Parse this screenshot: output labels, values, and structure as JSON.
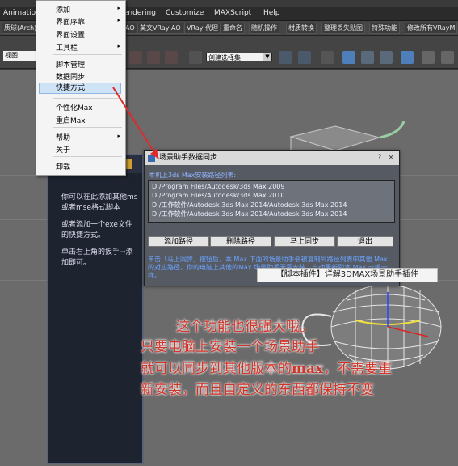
{
  "menubar": {
    "items": [
      "Animatio",
      "Rendering",
      "Customize",
      "MAXScript",
      "Help"
    ]
  },
  "plugin_toolbar": {
    "items": [
      "质球(Arch)",
      "AO",
      "英文VRay AO",
      "VRay 代理",
      "重命名",
      "随机操作",
      "材质转换",
      "整理丢失贴图",
      "特殊功能",
      "修改所有VRayM"
    ]
  },
  "icon_toolbar": {
    "view_dropdown": "视图",
    "selection_set": "创建选择集"
  },
  "dropdown_menu": {
    "items": [
      {
        "label": "添加",
        "submenu": true
      },
      {
        "label": "界面序靠",
        "submenu": true
      },
      {
        "label": "界面设置",
        "submenu": false
      },
      {
        "label": "工具栏",
        "submenu": true
      },
      {
        "label": "脚本管理",
        "submenu": false
      },
      {
        "label": "数据同步",
        "submenu": false
      },
      {
        "label": "快捷方式",
        "submenu": false
      },
      {
        "label": "个性化Max",
        "submenu": false
      },
      {
        "label": "重启Max",
        "submenu": false
      },
      {
        "label": "帮助",
        "submenu": true
      },
      {
        "label": "关于",
        "submenu": false
      },
      {
        "label": "卸载",
        "submenu": false
      }
    ],
    "submenu_arrow": "▸"
  },
  "help_panel": {
    "para1": "你可以在此添加其他ms或者mse格式脚本",
    "para2": "或者添加一个exe文件的快捷方式。",
    "para3": "单击右上角的扳手→添加即可。"
  },
  "sync_dialog": {
    "title": "场景助手数据同步",
    "list_label": "本机上3ds Max安装路径列表:",
    "paths": [
      "D:/Program Files/Autodesk/3ds Max 2009",
      "D:/Program Files/Autodesk/3ds Max 2010",
      "D:/工作软件/Autodesk 3ds Max 2014/Autodesk 3ds Max 2014",
      "D:/工作软件/Autodesk 3ds Max 2014/Autodesk 3ds Max 2014"
    ],
    "buttons": {
      "add": "添加路径",
      "delete": "删除路径",
      "sync": "马上同步",
      "exit": "退出"
    },
    "note": "单击「马上同步」按钮后，本 Max 下面的场景助手会被复制到路径列表中其他 Max 的对应路径，你的电脑上其他的Max 场景助手无需安装，自动更新到本 Max 一模一样。",
    "window_buttons": [
      "?",
      "×"
    ]
  },
  "watermark": "【脚本插件】详解3DMAX场景助手插件",
  "caption": {
    "line1": "这个功能也很强大哦。",
    "line2": "只要电脑上安装一个场景助手",
    "line3a": "就可以同步到其他版本的",
    "line3b": "max",
    "line3c": "，不需要重",
    "line4": "新安装，而且自定义的东西都保持不变"
  },
  "colors": {
    "annotation_red": "#d1352a",
    "menu_highlight": "#cfe3f7",
    "dialog_bg": "#565a63",
    "panel_bg": "#1e2330"
  }
}
